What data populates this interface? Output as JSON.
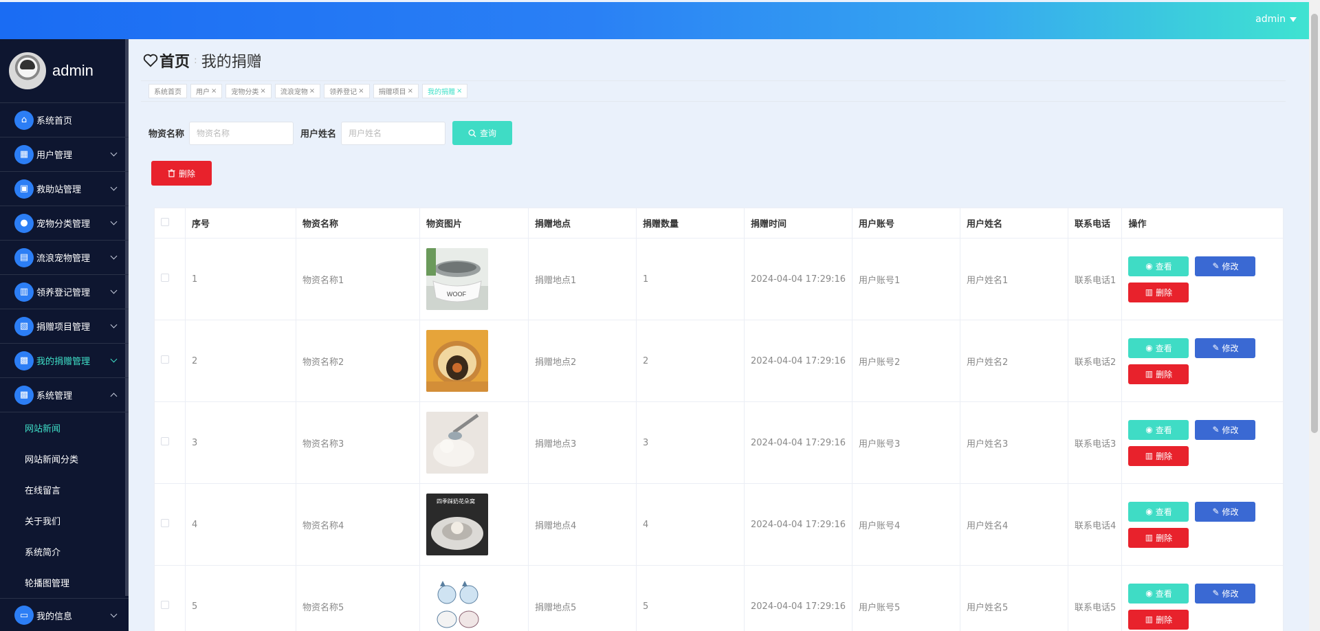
{
  "header": {
    "user": "admin"
  },
  "sidebar": {
    "username": "admin",
    "items": [
      {
        "label": "系统首页",
        "icon": "home-icon",
        "glyph": "⌂"
      },
      {
        "label": "用户管理",
        "icon": "users-icon",
        "glyph": "▦"
      },
      {
        "label": "救助站管理",
        "icon": "briefcase-icon",
        "glyph": "▣"
      },
      {
        "label": "宠物分类管理",
        "icon": "person-icon",
        "glyph": "●"
      },
      {
        "label": "流浪宠物管理",
        "icon": "clipboard-icon",
        "glyph": "▤"
      },
      {
        "label": "领养登记管理",
        "icon": "chart-icon",
        "glyph": "▥"
      },
      {
        "label": "捐赠项目管理",
        "icon": "document-icon",
        "glyph": "▧"
      },
      {
        "label": "我的捐赠管理",
        "icon": "grid-icon",
        "glyph": "▩"
      },
      {
        "label": "系统管理",
        "icon": "grid-icon",
        "glyph": "▩"
      }
    ],
    "sub_items": [
      "网站新闻",
      "网站新闻分类",
      "在线留言",
      "关于我们",
      "系统简介",
      "轮播图管理"
    ],
    "last_item": {
      "label": "我的信息",
      "icon": "card-icon",
      "glyph": "▭"
    }
  },
  "breadcrumb": {
    "home": "首页",
    "current": "我的捐赠"
  },
  "tags": [
    "系统首页",
    "用户",
    "宠物分类",
    "流浪宠物",
    "领养登记",
    "捐赠项目",
    "我的捐赠"
  ],
  "search": {
    "field1_label": "物资名称",
    "field1_placeholder": "物资名称",
    "field2_label": "用户姓名",
    "field2_placeholder": "用户姓名",
    "button": "查询"
  },
  "actions": {
    "delete": "删除"
  },
  "table": {
    "headers": [
      "序号",
      "物资名称",
      "物资图片",
      "捐赠地点",
      "捐赠数量",
      "捐赠时间",
      "用户账号",
      "用户姓名",
      "联系电话",
      "操作"
    ],
    "rows": [
      {
        "no": "1",
        "name": "物资名称1",
        "image": "pet-bowl-image",
        "place": "捐赠地点1",
        "qty": "1",
        "time": "2024-04-04 17:29:16",
        "account": "用户账号1",
        "uname": "用户姓名1",
        "phone": "联系电话1"
      },
      {
        "no": "2",
        "name": "物资名称2",
        "image": "pet-house-image",
        "place": "捐赠地点2",
        "qty": "2",
        "time": "2024-04-04 17:29:16",
        "account": "用户账号2",
        "uname": "用户姓名2",
        "phone": "联系电话2"
      },
      {
        "no": "3",
        "name": "物资名称3",
        "image": "pet-brush-image",
        "place": "捐赠地点3",
        "qty": "3",
        "time": "2024-04-04 17:29:16",
        "account": "用户账号3",
        "uname": "用户姓名3",
        "phone": "联系电话3"
      },
      {
        "no": "4",
        "name": "物资名称4",
        "image": "pet-bed-image",
        "caption": "四季踩奶花朵窝",
        "place": "捐赠地点4",
        "qty": "4",
        "time": "2024-04-04 17:29:16",
        "account": "用户账号4",
        "uname": "用户姓名4",
        "phone": "联系电话4"
      },
      {
        "no": "5",
        "name": "物资名称5",
        "image": "cat-bowls-image",
        "place": "捐赠地点5",
        "qty": "5",
        "time": "2024-04-04 17:29:16",
        "account": "用户账号5",
        "uname": "用户姓名5",
        "phone": "联系电话5"
      }
    ],
    "op_view": "查看",
    "op_edit": "修改",
    "op_delete": "删除"
  },
  "colors": {
    "accent": "#3fdcc5",
    "primary": "#3a69d3",
    "danger": "#e8222c",
    "sidebar": "#0e1630"
  }
}
